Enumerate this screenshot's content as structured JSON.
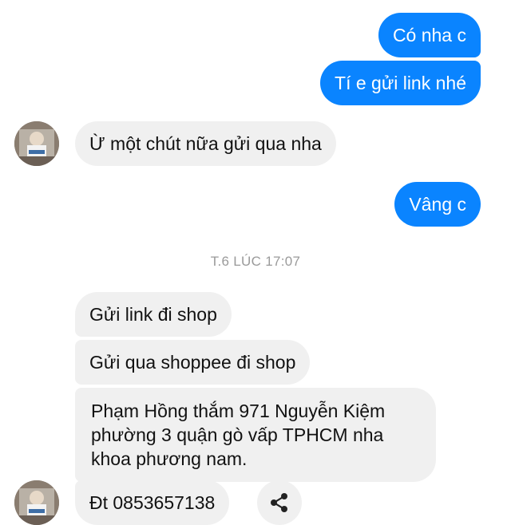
{
  "messages": {
    "m1": "Có nha c",
    "m2": "Tí e gửi link nhé",
    "m3": "Ừ một chút nữa gửi qua nha",
    "m4": "Vâng c",
    "m5": "Gửi link đi shop",
    "m6": "Gửi qua shoppee đi shop",
    "m7": "Phạm Hồng thắm 971 Nguyễn Kiệm phường 3 quận gò vấp TPHCM nha khoa phương nam.",
    "m8": "Đt 0853657138"
  },
  "timestamp": "T.6 LÚC 17:07",
  "icons": {
    "share": "share-icon",
    "avatar": "avatar"
  },
  "colors": {
    "outgoing_bubble": "#0a84ff",
    "incoming_bubble": "#f0f0f0",
    "timestamp_text": "#9a9a9a"
  }
}
